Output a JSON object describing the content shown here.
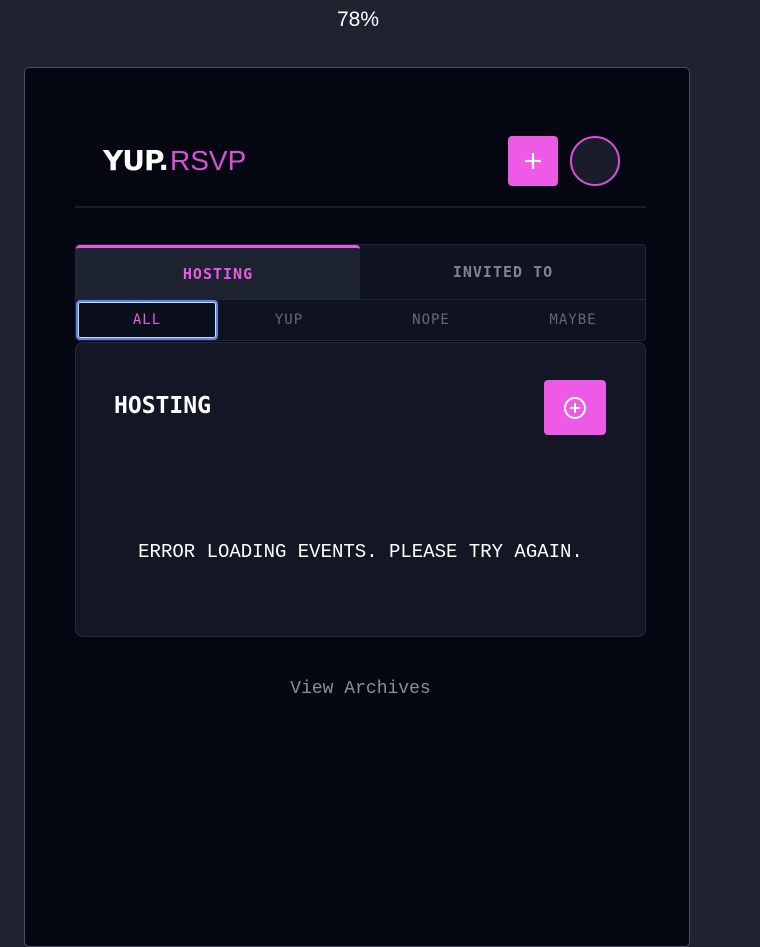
{
  "zoom": "78%",
  "logo": {
    "brand": "YUP.",
    "product": "RSVP"
  },
  "header": {
    "add_icon": "plus-icon",
    "avatar_icon": "avatar-circle"
  },
  "tabs": [
    {
      "label": "HOSTING",
      "active": true
    },
    {
      "label": "INVITED TO",
      "active": false
    }
  ],
  "filters": [
    {
      "label": "ALL",
      "active": true
    },
    {
      "label": "YUP",
      "active": false
    },
    {
      "label": "NOPE",
      "active": false
    },
    {
      "label": "MAYBE",
      "active": false
    }
  ],
  "card": {
    "title": "HOSTING",
    "add_icon": "plus-circle-icon",
    "error": "ERROR LOADING EVENTS. PLEASE TRY AGAIN."
  },
  "footer": {
    "archives_link": "View Archives"
  },
  "colors": {
    "accent": "#ec5ae6",
    "background": "#040611",
    "card": "#121625",
    "focus_ring": "#5a86e8"
  }
}
